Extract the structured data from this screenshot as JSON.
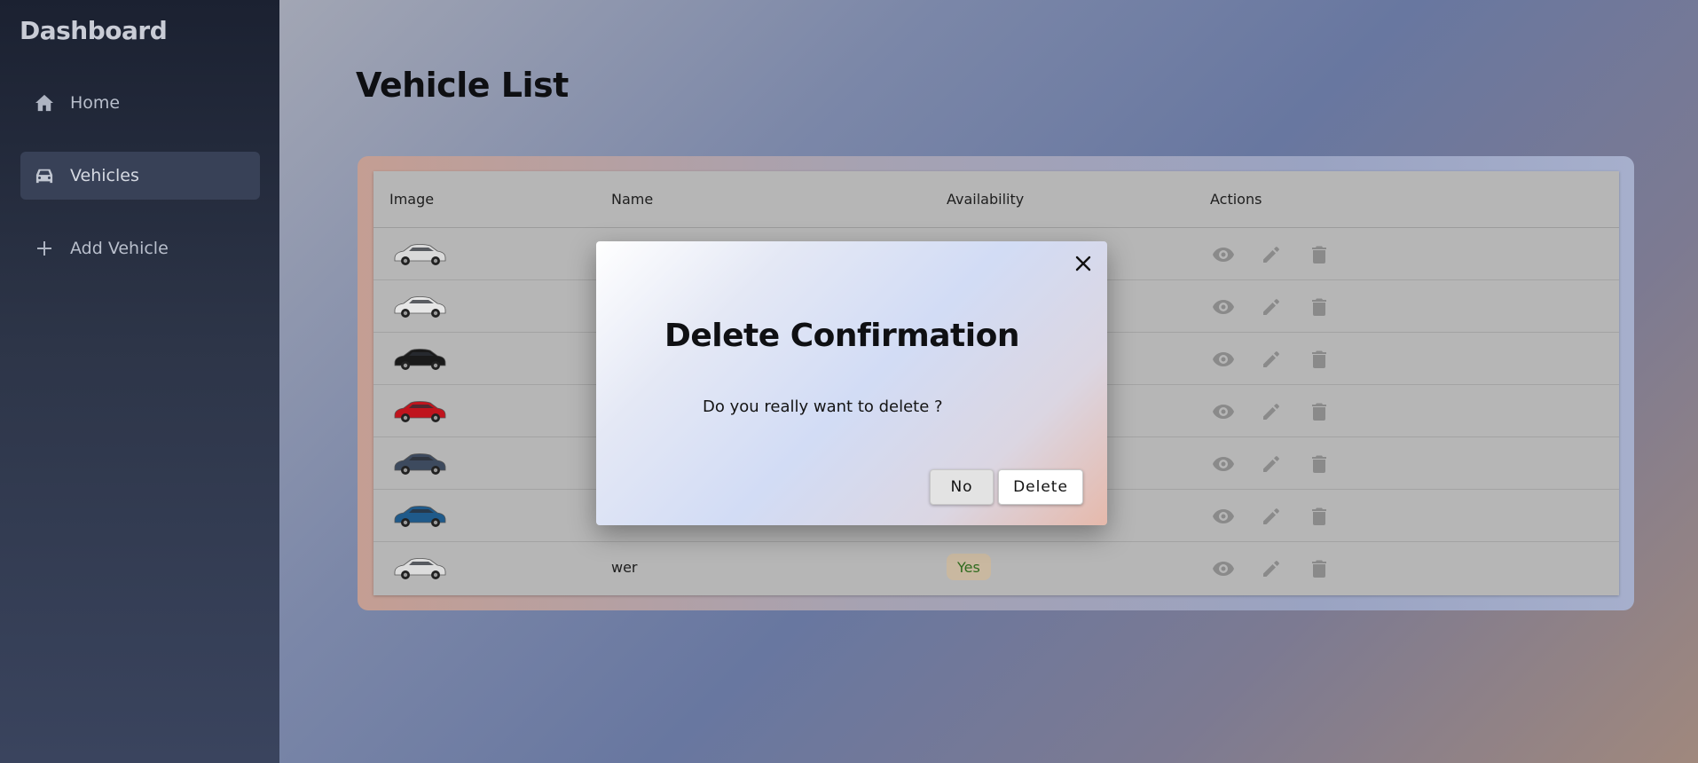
{
  "sidebar": {
    "brand": "Dashboard",
    "items": [
      {
        "label": "Home",
        "icon": "home-icon"
      },
      {
        "label": "Vehicles",
        "icon": "car-icon",
        "active": true
      },
      {
        "label": "Add Vehicle",
        "icon": "plus-icon"
      }
    ]
  },
  "main": {
    "title": "Vehicle List",
    "table": {
      "headers": [
        "Image",
        "Name",
        "Availability",
        "Actions"
      ],
      "rows": [
        {
          "car_color": "#d9d9d9",
          "name": "",
          "availability": ""
        },
        {
          "car_color": "#e6e6e6",
          "name": "",
          "availability": ""
        },
        {
          "car_color": "#1a1a1a",
          "name": "",
          "availability": ""
        },
        {
          "car_color": "#c0141d",
          "name": "",
          "availability": ""
        },
        {
          "car_color": "#3d4a5e",
          "name": "",
          "availability": ""
        },
        {
          "car_color": "#1f5a8a",
          "name": "",
          "availability": ""
        },
        {
          "car_color": "#dcdcdc",
          "name": "wer",
          "availability": "Yes"
        }
      ],
      "action_icons": [
        "view-icon",
        "edit-icon",
        "delete-icon"
      ]
    }
  },
  "modal": {
    "title": "Delete Confirmation",
    "message": "Do you really want to delete ?",
    "no_label": "No",
    "delete_label": "Delete"
  }
}
